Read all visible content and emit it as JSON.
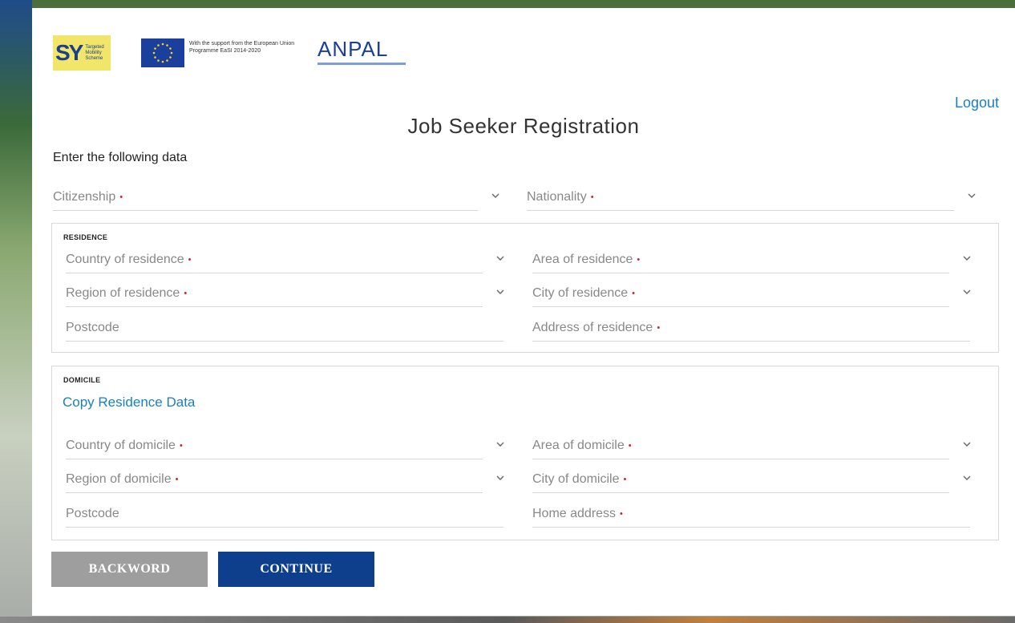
{
  "header": {
    "sy_mark": "SY",
    "sy_text": "Targeted Mobility Scheme",
    "eu_text": "With the support from the European Union Programme EaSI 2014-2020",
    "anpal": "ANPAL",
    "logout": "Logout"
  },
  "page": {
    "title": "Job Seeker Registration",
    "subtitle": "Enter the following data"
  },
  "citizenship": {
    "label": "Citizenship",
    "required": "•"
  },
  "nationality": {
    "label": "Nationality",
    "required": "•"
  },
  "residence": {
    "section_label": "RESIDENCE",
    "country": "Country of residence",
    "area": "Area of residence",
    "region": "Region of residence",
    "city": "City of residence",
    "postcode": "Postcode",
    "address": "Address of residence"
  },
  "domicile": {
    "section_label": "DOMICILE",
    "copy_link": "Copy Residence Data",
    "country": "Country of domicile",
    "area": "Area of domicile",
    "region": "Region of domicile",
    "city": "City of domicile",
    "postcode": "Postcode",
    "address": "Home address"
  },
  "buttons": {
    "back": "BACKWORD",
    "continue": "CONTINUE"
  },
  "colors": {
    "link": "#1a7fc0",
    "required": "#c62828",
    "primary_button": "#0d3f8c",
    "secondary_button": "#9e9e9e"
  }
}
